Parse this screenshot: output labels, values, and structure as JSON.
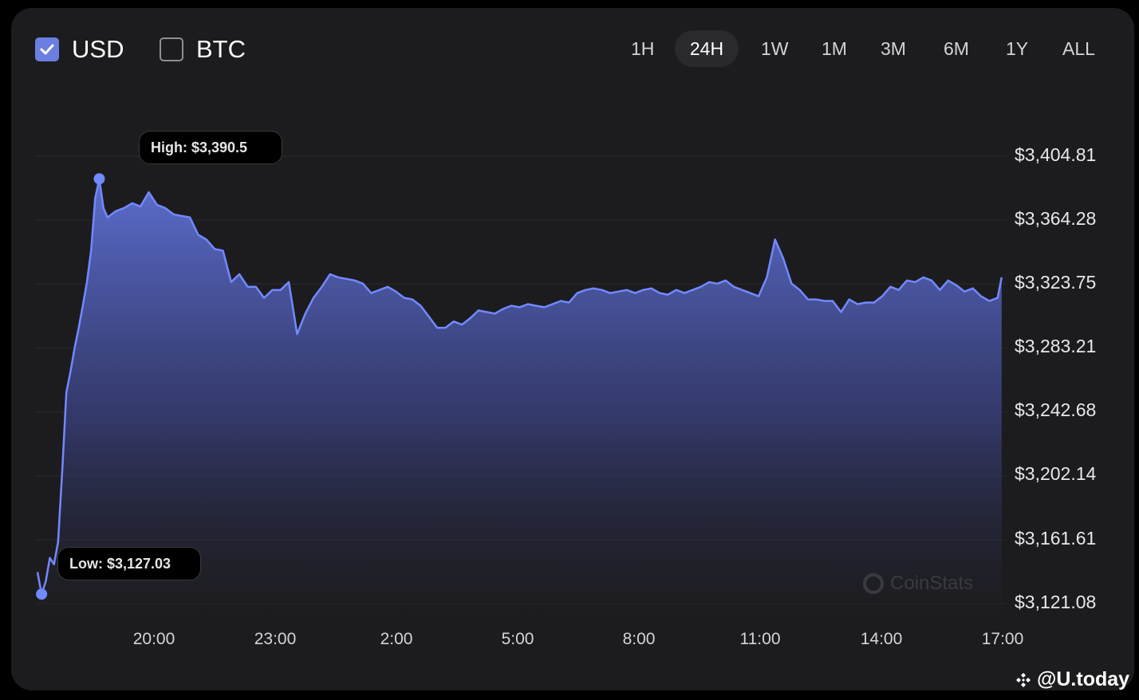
{
  "currency_toggles": [
    {
      "label": "USD",
      "checked": true
    },
    {
      "label": "BTC",
      "checked": false
    }
  ],
  "timeframes": [
    "1H",
    "24H",
    "1W",
    "1M",
    "3M",
    "6M",
    "1Y",
    "ALL"
  ],
  "active_timeframe": "24H",
  "tooltips": {
    "high": "High: $3,390.5",
    "low": "Low: $3,127.03"
  },
  "watermark": "CoinStats",
  "brand": "@U.today",
  "colors": {
    "accent": "#6b7fe0",
    "line": "#7289ff",
    "background": "#1c1c1e"
  },
  "chart_data": {
    "type": "area",
    "x_tick_labels": [
      "20:00",
      "23:00",
      "2:00",
      "5:00",
      "8:00",
      "11:00",
      "14:00",
      "17:00"
    ],
    "y_tick_labels": [
      "$3,404.81",
      "$3,364.28",
      "$3,323.75",
      "$3,283.21",
      "$3,242.68",
      "$3,202.14",
      "$3,161.61",
      "$3,121.08"
    ],
    "y_ticks": [
      3404.81,
      3364.28,
      3323.75,
      3283.21,
      3242.68,
      3202.14,
      3161.61,
      3121.08
    ],
    "ylim": [
      3121.08,
      3404.81
    ],
    "x_unit": "hours",
    "xlim": [
      17.7,
      41.2
    ],
    "x_ticks": [
      20,
      23,
      26,
      29,
      32,
      35,
      38,
      41
    ],
    "grid": true,
    "high": {
      "x": 19.2,
      "y": 3390.5
    },
    "low": {
      "x": 17.8,
      "y": 3127.03
    },
    "series": [
      {
        "values": [
          [
            17.7,
            3141
          ],
          [
            17.8,
            3127
          ],
          [
            17.9,
            3135
          ],
          [
            18.0,
            3150
          ],
          [
            18.1,
            3146
          ],
          [
            18.2,
            3160
          ],
          [
            18.3,
            3205
          ],
          [
            18.4,
            3255
          ],
          [
            18.5,
            3268
          ],
          [
            18.6,
            3283
          ],
          [
            18.7,
            3296
          ],
          [
            18.8,
            3310
          ],
          [
            18.9,
            3325
          ],
          [
            19.0,
            3345
          ],
          [
            19.1,
            3378
          ],
          [
            19.2,
            3390.5
          ],
          [
            19.3,
            3372
          ],
          [
            19.4,
            3366
          ],
          [
            19.6,
            3370
          ],
          [
            19.8,
            3372
          ],
          [
            20.0,
            3375
          ],
          [
            20.2,
            3373
          ],
          [
            20.4,
            3382
          ],
          [
            20.6,
            3374
          ],
          [
            20.8,
            3372
          ],
          [
            21.0,
            3368
          ],
          [
            21.2,
            3367
          ],
          [
            21.4,
            3366
          ],
          [
            21.6,
            3355
          ],
          [
            21.8,
            3352
          ],
          [
            22.0,
            3346
          ],
          [
            22.2,
            3345
          ],
          [
            22.4,
            3325
          ],
          [
            22.6,
            3330
          ],
          [
            22.8,
            3322
          ],
          [
            23.0,
            3322
          ],
          [
            23.2,
            3315
          ],
          [
            23.4,
            3320
          ],
          [
            23.6,
            3320
          ],
          [
            23.8,
            3325
          ],
          [
            24.0,
            3292
          ],
          [
            24.2,
            3305
          ],
          [
            24.4,
            3315
          ],
          [
            24.6,
            3322
          ],
          [
            24.8,
            3330
          ],
          [
            25.0,
            3328
          ],
          [
            25.2,
            3327
          ],
          [
            25.4,
            3326
          ],
          [
            25.6,
            3324
          ],
          [
            25.8,
            3318
          ],
          [
            26.0,
            3320
          ],
          [
            26.2,
            3322
          ],
          [
            26.4,
            3319
          ],
          [
            26.6,
            3315
          ],
          [
            26.8,
            3314
          ],
          [
            27.0,
            3310
          ],
          [
            27.2,
            3303
          ],
          [
            27.4,
            3296
          ],
          [
            27.6,
            3296
          ],
          [
            27.8,
            3300
          ],
          [
            28.0,
            3298
          ],
          [
            28.2,
            3302
          ],
          [
            28.4,
            3307
          ],
          [
            28.6,
            3306
          ],
          [
            28.8,
            3305
          ],
          [
            29.0,
            3308
          ],
          [
            29.2,
            3310
          ],
          [
            29.4,
            3309
          ],
          [
            29.6,
            3311
          ],
          [
            29.8,
            3310
          ],
          [
            30.0,
            3309
          ],
          [
            30.2,
            3311
          ],
          [
            30.4,
            3313
          ],
          [
            30.6,
            3312
          ],
          [
            30.8,
            3318
          ],
          [
            31.0,
            3320
          ],
          [
            31.2,
            3321
          ],
          [
            31.4,
            3320
          ],
          [
            31.6,
            3318
          ],
          [
            31.8,
            3319
          ],
          [
            32.0,
            3320
          ],
          [
            32.2,
            3318
          ],
          [
            32.4,
            3320
          ],
          [
            32.6,
            3321
          ],
          [
            32.8,
            3318
          ],
          [
            33.0,
            3317
          ],
          [
            33.2,
            3320
          ],
          [
            33.4,
            3318
          ],
          [
            33.6,
            3320
          ],
          [
            33.8,
            3322
          ],
          [
            34.0,
            3325
          ],
          [
            34.2,
            3324
          ],
          [
            34.4,
            3326
          ],
          [
            34.6,
            3322
          ],
          [
            34.8,
            3320
          ],
          [
            35.0,
            3318
          ],
          [
            35.2,
            3316
          ],
          [
            35.4,
            3328
          ],
          [
            35.6,
            3352
          ],
          [
            35.8,
            3340
          ],
          [
            36.0,
            3324
          ],
          [
            36.2,
            3320
          ],
          [
            36.4,
            3314
          ],
          [
            36.6,
            3314
          ],
          [
            36.8,
            3313
          ],
          [
            37.0,
            3313
          ],
          [
            37.2,
            3306
          ],
          [
            37.4,
            3314
          ],
          [
            37.6,
            3311
          ],
          [
            37.8,
            3312
          ],
          [
            38.0,
            3312
          ],
          [
            38.2,
            3316
          ],
          [
            38.4,
            3322
          ],
          [
            38.6,
            3320
          ],
          [
            38.8,
            3326
          ],
          [
            39.0,
            3325
          ],
          [
            39.2,
            3328
          ],
          [
            39.4,
            3326
          ],
          [
            39.6,
            3320
          ],
          [
            39.8,
            3326
          ],
          [
            40.0,
            3323
          ],
          [
            40.2,
            3319
          ],
          [
            40.4,
            3321
          ],
          [
            40.6,
            3316
          ],
          [
            40.8,
            3313
          ],
          [
            41.0,
            3315
          ],
          [
            41.1,
            3328
          ]
        ]
      }
    ]
  }
}
